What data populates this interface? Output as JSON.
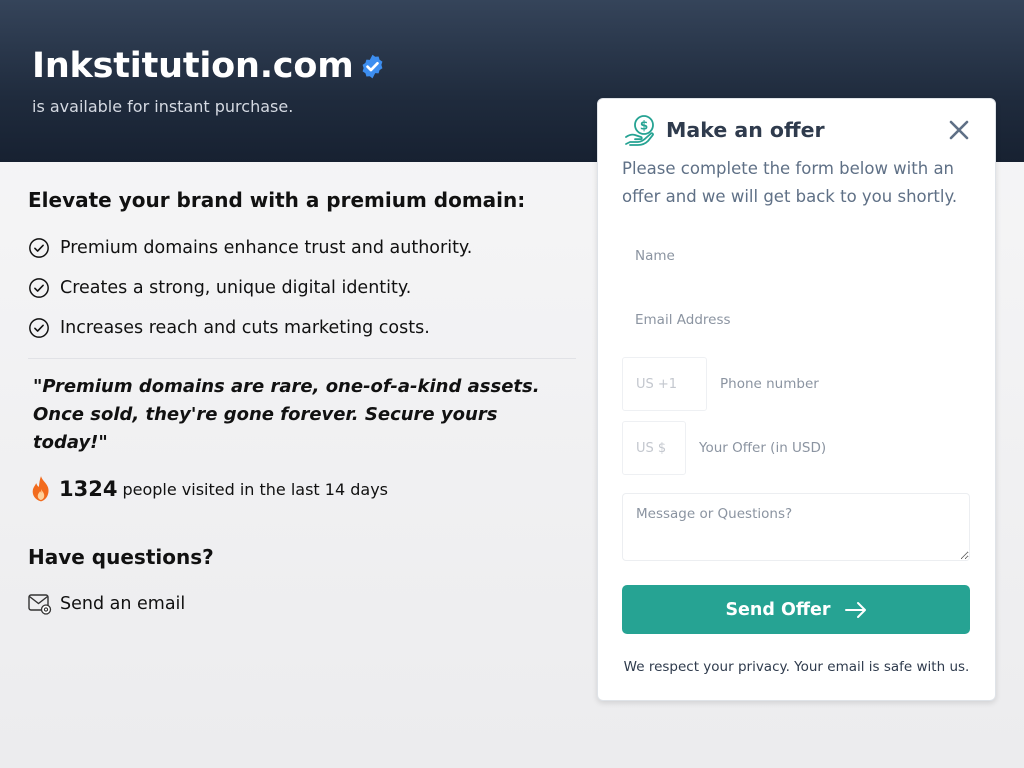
{
  "header": {
    "domain": "Inkstitution.com",
    "subtitle": "is available for instant purchase."
  },
  "left": {
    "pitch_title": "Elevate your brand with a premium domain:",
    "benefits": [
      "Premium domains enhance trust and authority.",
      "Creates a strong, unique digital identity.",
      "Increases reach and cuts marketing costs."
    ],
    "quote": "\"Premium domains are rare, one-of-a-kind assets. Once sold, they're gone forever. Secure yours today!\"",
    "visits": {
      "count": "1324",
      "text": "people visited in the last 14 days"
    },
    "questions_title": "Have questions?",
    "email_link": "Send an email"
  },
  "offer_form": {
    "title": "Make an offer",
    "description": "Please complete the form below with an offer and we will get back to you shortly.",
    "name_placeholder": "Name",
    "email_placeholder": "Email Address",
    "phone_prefix": "US +1",
    "phone_placeholder": "Phone number",
    "offer_prefix": "US $",
    "offer_placeholder": "Your Offer (in USD)",
    "message_placeholder": "Message or Questions?",
    "submit_label": "Send Offer",
    "privacy_note": "We respect your privacy. Your email is safe with us."
  },
  "colors": {
    "accent": "#26a393",
    "hero_dark": "#1f2b3d",
    "verified_blue": "#3d8ef0",
    "fire_orange": "#f26b1d"
  },
  "icons": [
    "verified-badge-icon",
    "check-circle-icon",
    "fire-icon",
    "mail-icon",
    "money-hand-icon",
    "close-icon",
    "arrow-right-icon"
  ]
}
